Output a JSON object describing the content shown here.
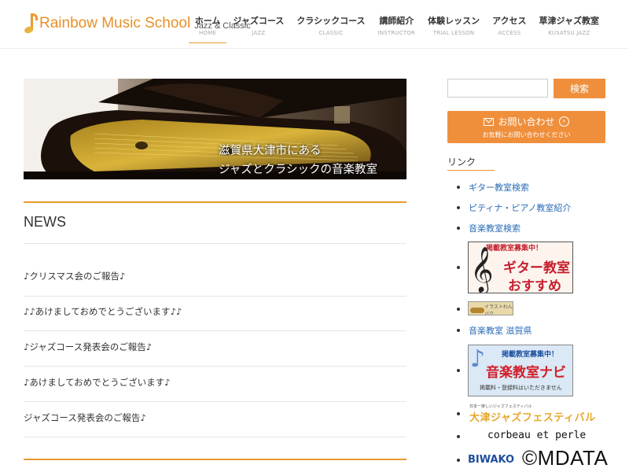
{
  "header": {
    "logo_main": "Rainbow Music School",
    "logo_sub": "Jazz & Classic",
    "nav": [
      {
        "jp": "ホーム",
        "en": "HOME"
      },
      {
        "jp": "ジャズコース",
        "en": "JAZZ"
      },
      {
        "jp": "クラシックコース",
        "en": "CLASSIC"
      },
      {
        "jp": "講師紹介",
        "en": "INSTRUCTOR"
      },
      {
        "jp": "体験レッスン",
        "en": "TRIAL LESSON"
      },
      {
        "jp": "アクセス",
        "en": "ACCESS"
      },
      {
        "jp": "草津ジャズ教室",
        "en": "KUSATSU JAZZ"
      }
    ],
    "active_index": 0
  },
  "hero": {
    "caption_line1": "滋賀県大津市にある",
    "caption_line2": "ジャズとクラシックの音楽教室"
  },
  "news": {
    "title": "NEWS",
    "items": [
      "♪クリスマス会のご報告♪",
      "♪♪あけましておめでとうございます♪♪",
      "♪ジャズコース発表会のご報告♪",
      "♪あけましておめでとうございます♪",
      "ジャズコース発表会のご報告♪"
    ]
  },
  "sidebar": {
    "search_placeholder": "",
    "search_button": "検索",
    "contact_main": "お問い合わせ",
    "contact_sub": "お気軽にお問い合わせください",
    "links_title": "リンク",
    "links": [
      "ギター教室検索",
      "ピティナ・ピアノ教室紹介",
      "音楽教室検索",
      "音楽教室 滋賀県"
    ],
    "banner_guitar": {
      "top": "掲載教室募集中！",
      "main1": "ギター教室",
      "main2": "おすすめ"
    },
    "banner_small": "イラストわんパク",
    "banner_navi": {
      "top": "掲載教室募集中！",
      "main": "音楽教室ナビ",
      "foot": "掲載料・登録料はいただきません"
    },
    "banner_jazzfes": {
      "small": "日本一楽しいジャズフェスティバル",
      "main": "大津ジャズフェスティバル"
    },
    "banner_corbeau": "corbeau et perle",
    "banner_biwako": "BIWAKO"
  },
  "watermark": "©MDATA",
  "colors": {
    "accent": "#ef8f3c",
    "link": "#2a6db5",
    "logo": "#e8902a"
  }
}
